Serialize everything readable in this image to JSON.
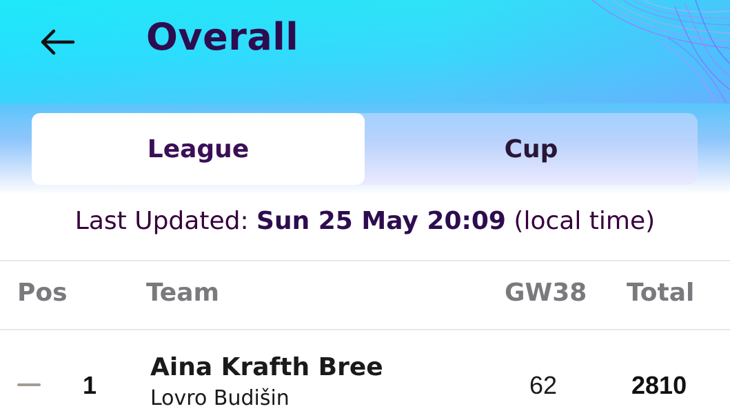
{
  "header": {
    "title": "Overall",
    "back_icon": "arrow-left-icon"
  },
  "tabs": [
    {
      "label": "League",
      "active": true
    },
    {
      "label": "Cup",
      "active": false
    }
  ],
  "last_updated": {
    "prefix": "Last Updated: ",
    "value": "Sun 25 May 20:09",
    "suffix": " (local time)"
  },
  "table": {
    "columns": {
      "pos": "Pos",
      "team": "Team",
      "gw": "GW38",
      "total": "Total"
    },
    "rows": [
      {
        "movement_icon": "no-change-dash-icon",
        "pos": "1",
        "team": "Aina Krafth Bree",
        "manager": "Lovro Budišin",
        "gw": "62",
        "total": "2810"
      }
    ]
  },
  "colors": {
    "brand_purple": "#37003c",
    "header_cyan": "#2ee3f8"
  }
}
